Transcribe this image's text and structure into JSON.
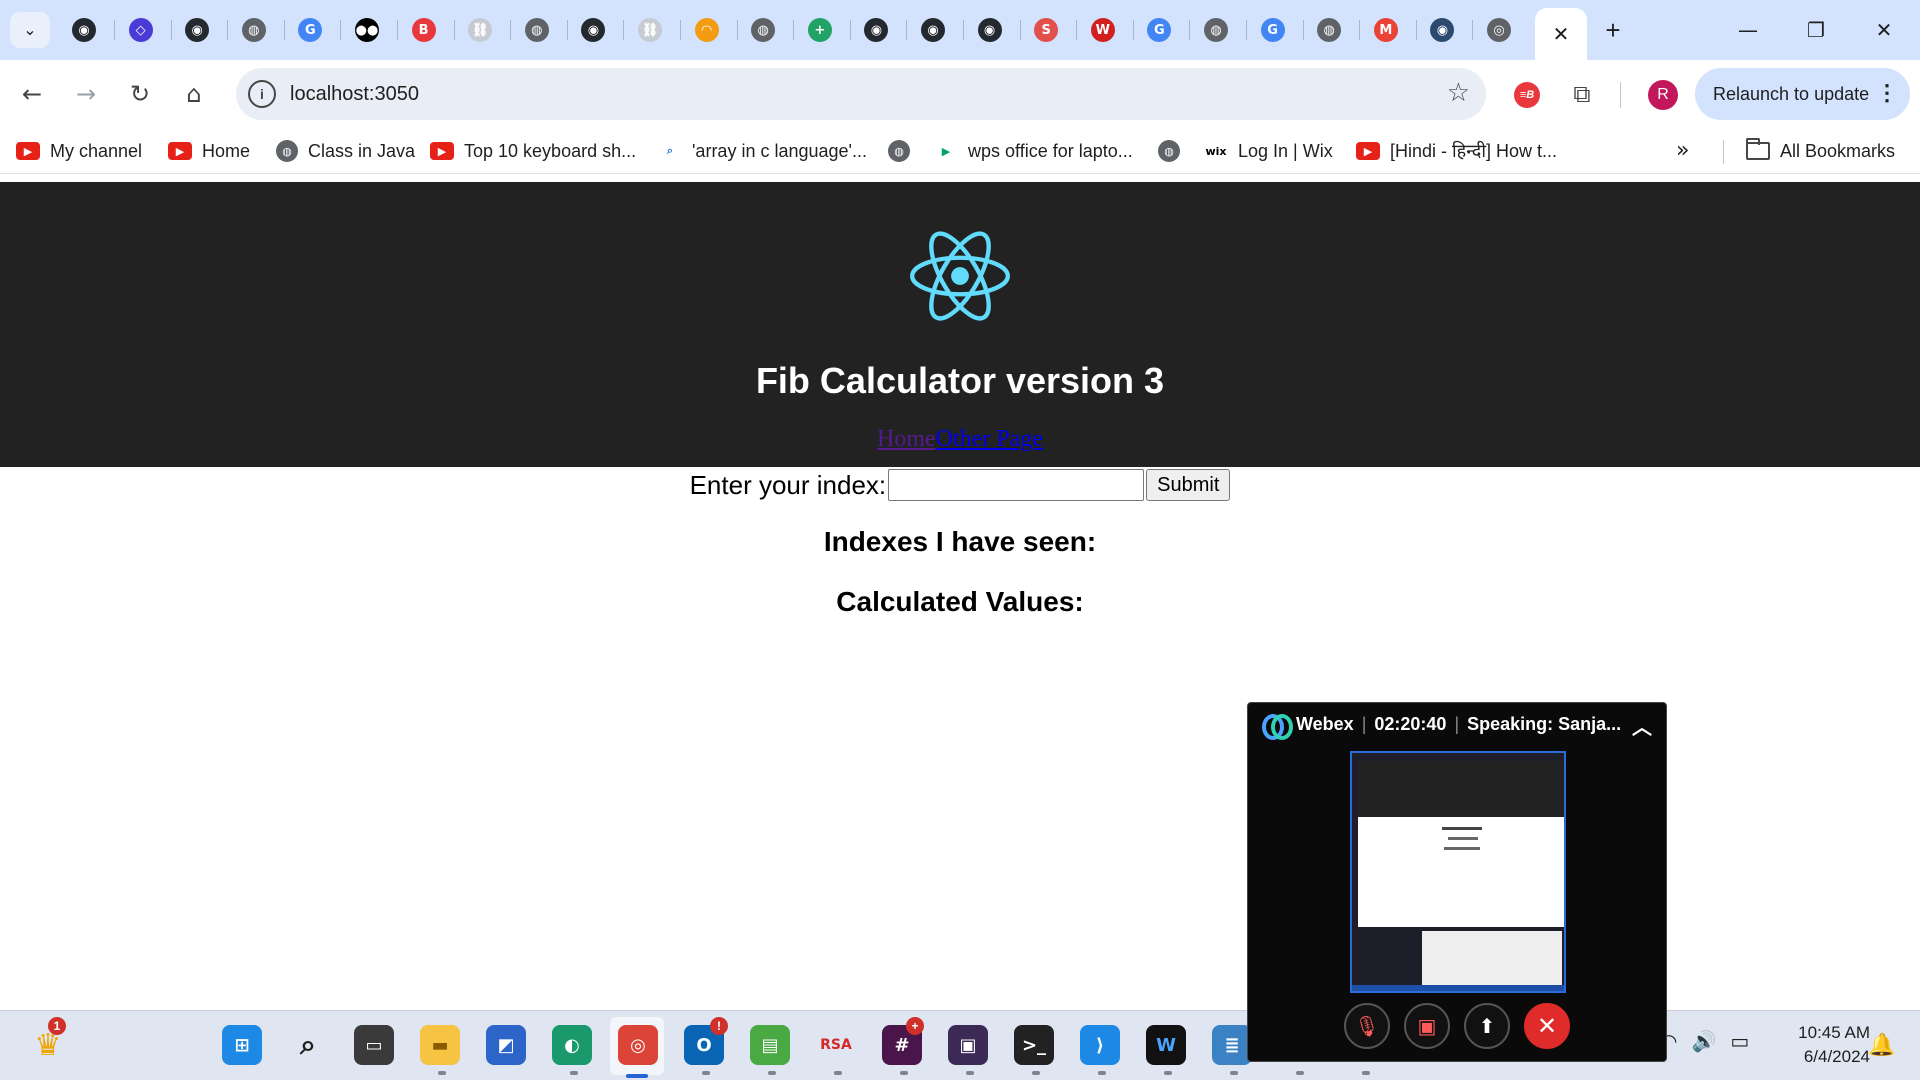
{
  "browser": {
    "tabs": [
      {
        "icon": "github-icon",
        "color": "#24292f",
        "glyph": "◉"
      },
      {
        "icon": "code-brackets-icon",
        "color": "#4b3bd6",
        "glyph": "◇"
      },
      {
        "icon": "github-icon",
        "color": "#24292f",
        "glyph": "◉"
      },
      {
        "icon": "globe-icon",
        "color": "#5f6368",
        "glyph": "◍"
      },
      {
        "icon": "google-icon",
        "color": "#4285f4",
        "glyph": "G"
      },
      {
        "icon": "medium-icon",
        "color": "#000000",
        "glyph": "●●"
      },
      {
        "icon": "rb-icon",
        "color": "#e8383d",
        "glyph": "B"
      },
      {
        "icon": "link-icon",
        "color": "#c5cad3",
        "glyph": "⛓"
      },
      {
        "icon": "globe-icon",
        "color": "#5f6368",
        "glyph": "◍"
      },
      {
        "icon": "github-icon",
        "color": "#24292f",
        "glyph": "◉"
      },
      {
        "icon": "link-icon",
        "color": "#c5cad3",
        "glyph": "⛓"
      },
      {
        "icon": "rainbow-icon",
        "color": "#f39c12",
        "glyph": "◠"
      },
      {
        "icon": "globe-icon",
        "color": "#5f6368",
        "glyph": "◍"
      },
      {
        "icon": "plus-sheet-icon",
        "color": "#21a366",
        "glyph": "+"
      },
      {
        "icon": "github-icon",
        "color": "#24292f",
        "glyph": "◉"
      },
      {
        "icon": "github-icon",
        "color": "#24292f",
        "glyph": "◉"
      },
      {
        "icon": "github-icon",
        "color": "#24292f",
        "glyph": "◉"
      },
      {
        "icon": "s-icon",
        "color": "#e2504c",
        "glyph": "S"
      },
      {
        "icon": "w-icon",
        "color": "#d1201f",
        "glyph": "W"
      },
      {
        "icon": "google-icon",
        "color": "#4285f4",
        "glyph": "G"
      },
      {
        "icon": "globe-icon",
        "color": "#5f6368",
        "glyph": "◍"
      },
      {
        "icon": "google-icon",
        "color": "#4285f4",
        "glyph": "G"
      },
      {
        "icon": "globe-icon",
        "color": "#5f6368",
        "glyph": "◍"
      },
      {
        "icon": "gmail-icon",
        "color": "#ea4335",
        "glyph": "M"
      },
      {
        "icon": "docker-icon",
        "color": "#2b4a6f",
        "glyph": "◉"
      },
      {
        "icon": "chrome-icon",
        "color": "#5f6368",
        "glyph": "◎"
      }
    ],
    "active_tab_close": "✕",
    "new_tab": "+",
    "window_controls": {
      "minimize": "—",
      "restore": "❐",
      "close": "✕"
    },
    "toolbar": {
      "back": "←",
      "forward": "→",
      "reload": "↻",
      "home": "⌂",
      "site_info": "i",
      "url": "localhost:3050",
      "star": "☆",
      "extension_rb": "≡B",
      "extensions": "⧉",
      "profile_initial": "R",
      "relaunch_label": "Relaunch to update",
      "menu": "⋮"
    },
    "bookmarks": [
      {
        "label": "My channel",
        "icon": "youtube-icon"
      },
      {
        "label": "Home",
        "icon": "youtube-icon"
      },
      {
        "label": "Class in Java",
        "icon": "globe-icon"
      },
      {
        "label": "Top 10 keyboard sh...",
        "icon": "youtube-icon"
      },
      {
        "label": "'array in c language'...",
        "icon": "search-bot-icon"
      },
      {
        "label": "",
        "icon": "globe-icon"
      },
      {
        "label": "wps office for lapto...",
        "icon": "play-store-icon"
      },
      {
        "label": "",
        "icon": "globe-icon"
      },
      {
        "label": "Log In | Wix",
        "icon": "wix-icon"
      },
      {
        "label": "[Hindi - हिन्दी] How t...",
        "icon": "youtube-icon"
      }
    ],
    "bookmarks_more": "»",
    "all_bookmarks": "All Bookmarks"
  },
  "app": {
    "title": "Fib Calculator version 3",
    "links": {
      "home": "Home",
      "other": "Other Page"
    },
    "form": {
      "label": "Enter your index:",
      "input_value": "",
      "submit": "Submit"
    },
    "indexes_heading": "Indexes I have seen:",
    "values_heading": "Calculated Values:"
  },
  "webex": {
    "name": "Webex",
    "timer": "02:20:40",
    "speaking": "Speaking: Sanja...",
    "collapse": "︿",
    "buttons": {
      "mute": "🎙",
      "video": "▣",
      "share": "⬆",
      "end": "✕"
    }
  },
  "taskbar": {
    "trophy_badge": "1",
    "outlook_badge": "!",
    "slack_badge": "+",
    "clock_time": "10:45 AM",
    "clock_date": "6/4/2024",
    "tray": {
      "wifi": "◠",
      "volume": "🔊",
      "battery": "▭"
    },
    "notifications": "🔔"
  },
  "colors": {
    "tabstrip_bg": "#d3e3fd",
    "header_bg": "#222222",
    "react_cyan": "#61dafb",
    "visited_link": "#551a8b",
    "link": "#0000ee",
    "webex_end": "#e02b2b"
  }
}
